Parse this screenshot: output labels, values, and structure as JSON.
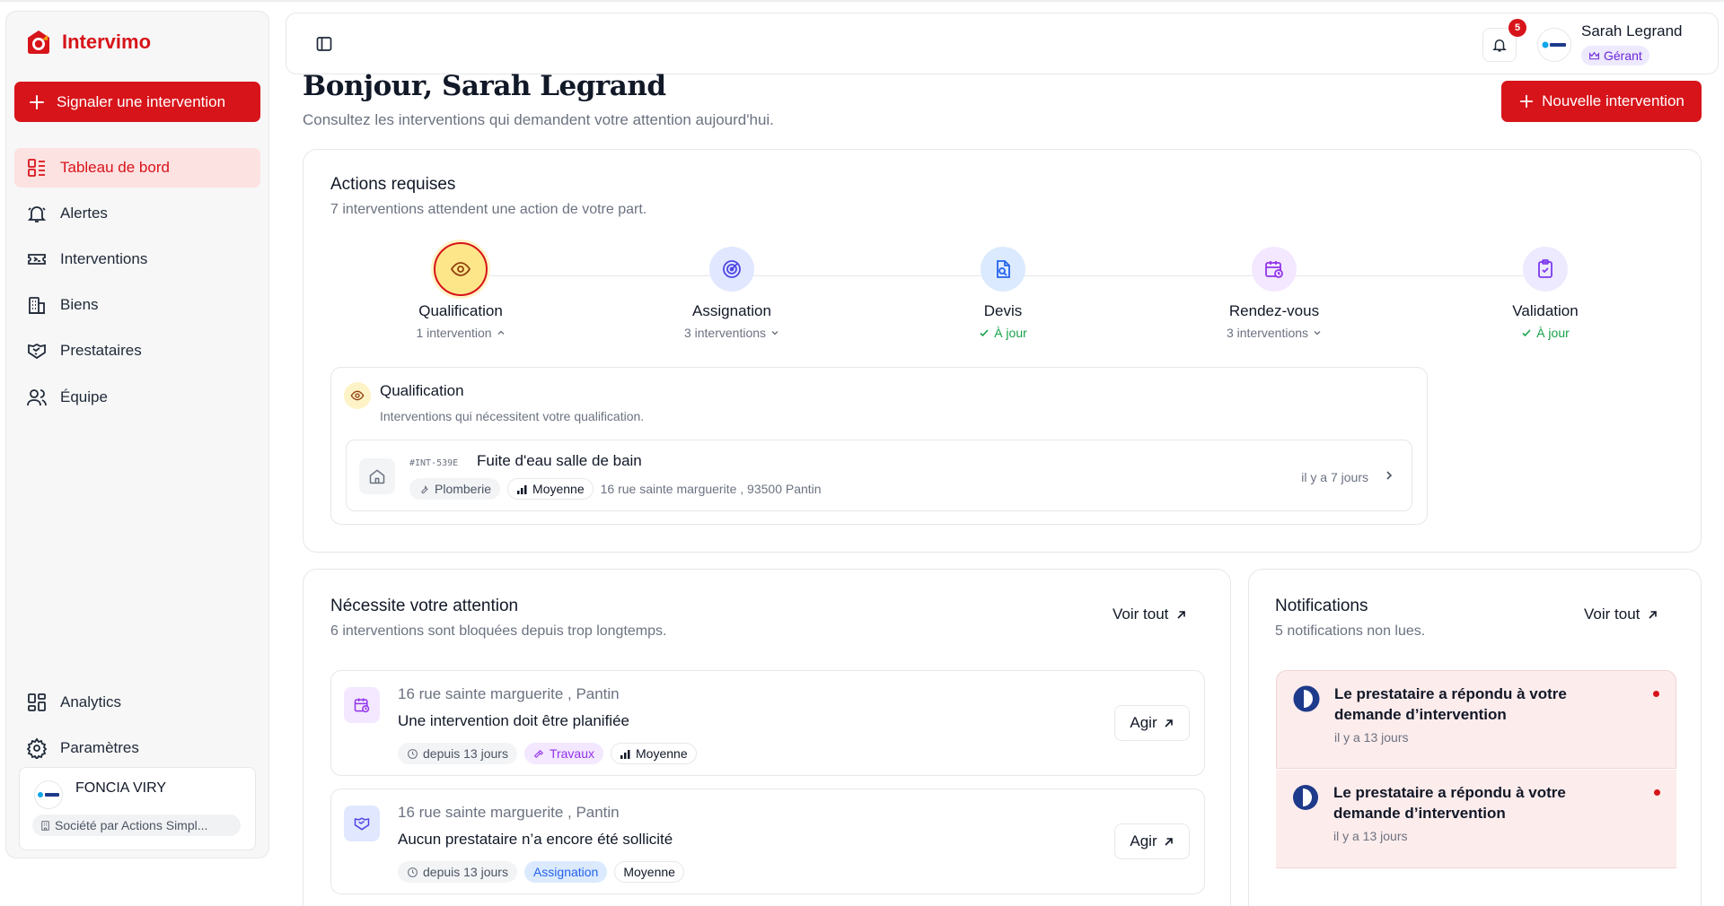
{
  "app": {
    "name": "Intervimo"
  },
  "sidebar": {
    "cta_label": "Signaler une intervention",
    "nav": [
      {
        "label": "Tableau de bord",
        "icon": "dashboard-icon",
        "active": true
      },
      {
        "label": "Alertes",
        "icon": "bell-icon"
      },
      {
        "label": "Interventions",
        "icon": "ticket-icon"
      },
      {
        "label": "Biens",
        "icon": "building-icon"
      },
      {
        "label": "Prestataires",
        "icon": "handshake-icon"
      },
      {
        "label": "Équipe",
        "icon": "users-icon"
      }
    ],
    "bottom_nav": [
      {
        "label": "Analytics",
        "icon": "grid-icon"
      },
      {
        "label": "Paramètres",
        "icon": "gear-icon"
      }
    ],
    "org": {
      "name": "FONCIA VIRY",
      "type": "Société par Actions Simpl..."
    }
  },
  "header": {
    "notification_count": "5",
    "user_name": "Sarah Legrand",
    "role": "Gérant"
  },
  "greeting": {
    "title": "Bonjour, Sarah Legrand",
    "subtitle": "Consultez les interventions qui demandent votre attention aujourd'hui.",
    "new_button": "Nouvelle intervention"
  },
  "actions": {
    "title": "Actions requises",
    "subtitle": "7 interventions attendent une action de votre part.",
    "steps": [
      {
        "label": "Qualification",
        "sub": "1 intervention",
        "status": "expanded"
      },
      {
        "label": "Assignation",
        "sub": "3 interventions",
        "status": "collapsed"
      },
      {
        "label": "Devis",
        "sub": "À jour",
        "status": "ok"
      },
      {
        "label": "Rendez-vous",
        "sub": "3 interventions",
        "status": "collapsed"
      },
      {
        "label": "Validation",
        "sub": "À jour",
        "status": "ok"
      }
    ],
    "panel": {
      "title": "Qualification",
      "subtitle": "Interventions qui nécessitent votre qualification.",
      "row": {
        "ref": "#INT-539E",
        "title": "Fuite d'eau salle de bain",
        "category": "Plomberie",
        "priority": "Moyenne",
        "address": "16 rue sainte marguerite , 93500 Pantin",
        "time": "il y a 7 jours"
      }
    }
  },
  "attention": {
    "title": "Nécessite votre attention",
    "subtitle": "6 interventions sont bloquées depuis trop longtemps.",
    "see_all": "Voir tout",
    "items": [
      {
        "address": "16 rue sainte marguerite , Pantin",
        "desc": "Une intervention doit être planifiée",
        "since": "depuis 13 jours",
        "category": "Travaux",
        "priority": "Moyenne",
        "action": "Agir"
      },
      {
        "address": "16 rue sainte marguerite , Pantin",
        "desc": "Aucun prestataire n’a encore été sollicité",
        "since": "depuis 13 jours",
        "category": "Assignation",
        "priority": "Moyenne",
        "action": "Agir"
      }
    ]
  },
  "notifications": {
    "title": "Notifications",
    "subtitle": "5 notifications non lues.",
    "see_all": "Voir tout",
    "items": [
      {
        "text": "Le prestataire a répondu à votre demande d’intervention",
        "time": "il y a 13 jours"
      },
      {
        "text": "Le prestataire a répondu à votre demande d’intervention",
        "time": "il y a 13 jours"
      }
    ]
  },
  "colors": {
    "brand": "#d7141a",
    "active_bg": "#fde2e2",
    "ok": "#16a34a",
    "purple": "#9333ea"
  }
}
